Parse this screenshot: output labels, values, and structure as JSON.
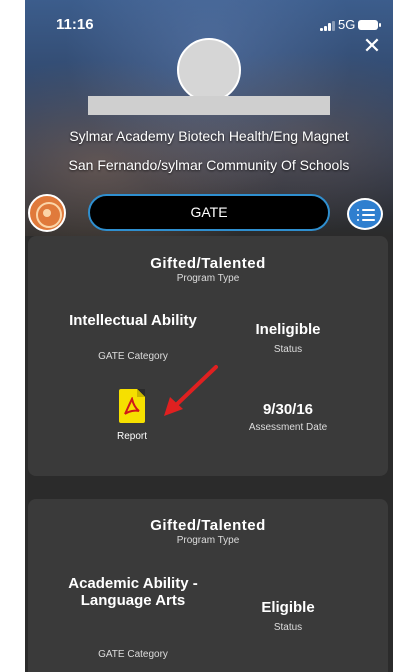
{
  "status_bar": {
    "time": "11:16",
    "network": "5G"
  },
  "header": {
    "school_name": "Sylmar Academy Biotech Health/Eng Magnet",
    "community": "San Fernando/sylmar Community Of Schools",
    "selector_label": "GATE",
    "close_icon": "close-icon",
    "menu_icon": "list-icon"
  },
  "colors": {
    "accent": "#2f8fcf",
    "card_bg": "#3a3a3a",
    "page_bg": "#2b2b2b",
    "pdf": "#f6e000",
    "annotation_arrow": "#e02020"
  },
  "records": [
    {
      "program_type": "Gifted/Talented",
      "program_type_label": "Program Type",
      "category": "Intellectual Ability",
      "category_label": "GATE Category",
      "status": "Ineligible",
      "status_label": "Status",
      "report_label": "Report",
      "assessment_date": "9/30/16",
      "assessment_date_label": "Assessment Date"
    },
    {
      "program_type": "Gifted/Talented",
      "program_type_label": "Program Type",
      "category": "Academic Ability - Language Arts",
      "category_label": "GATE Category",
      "status": "Eligible",
      "status_label": "Status"
    }
  ]
}
